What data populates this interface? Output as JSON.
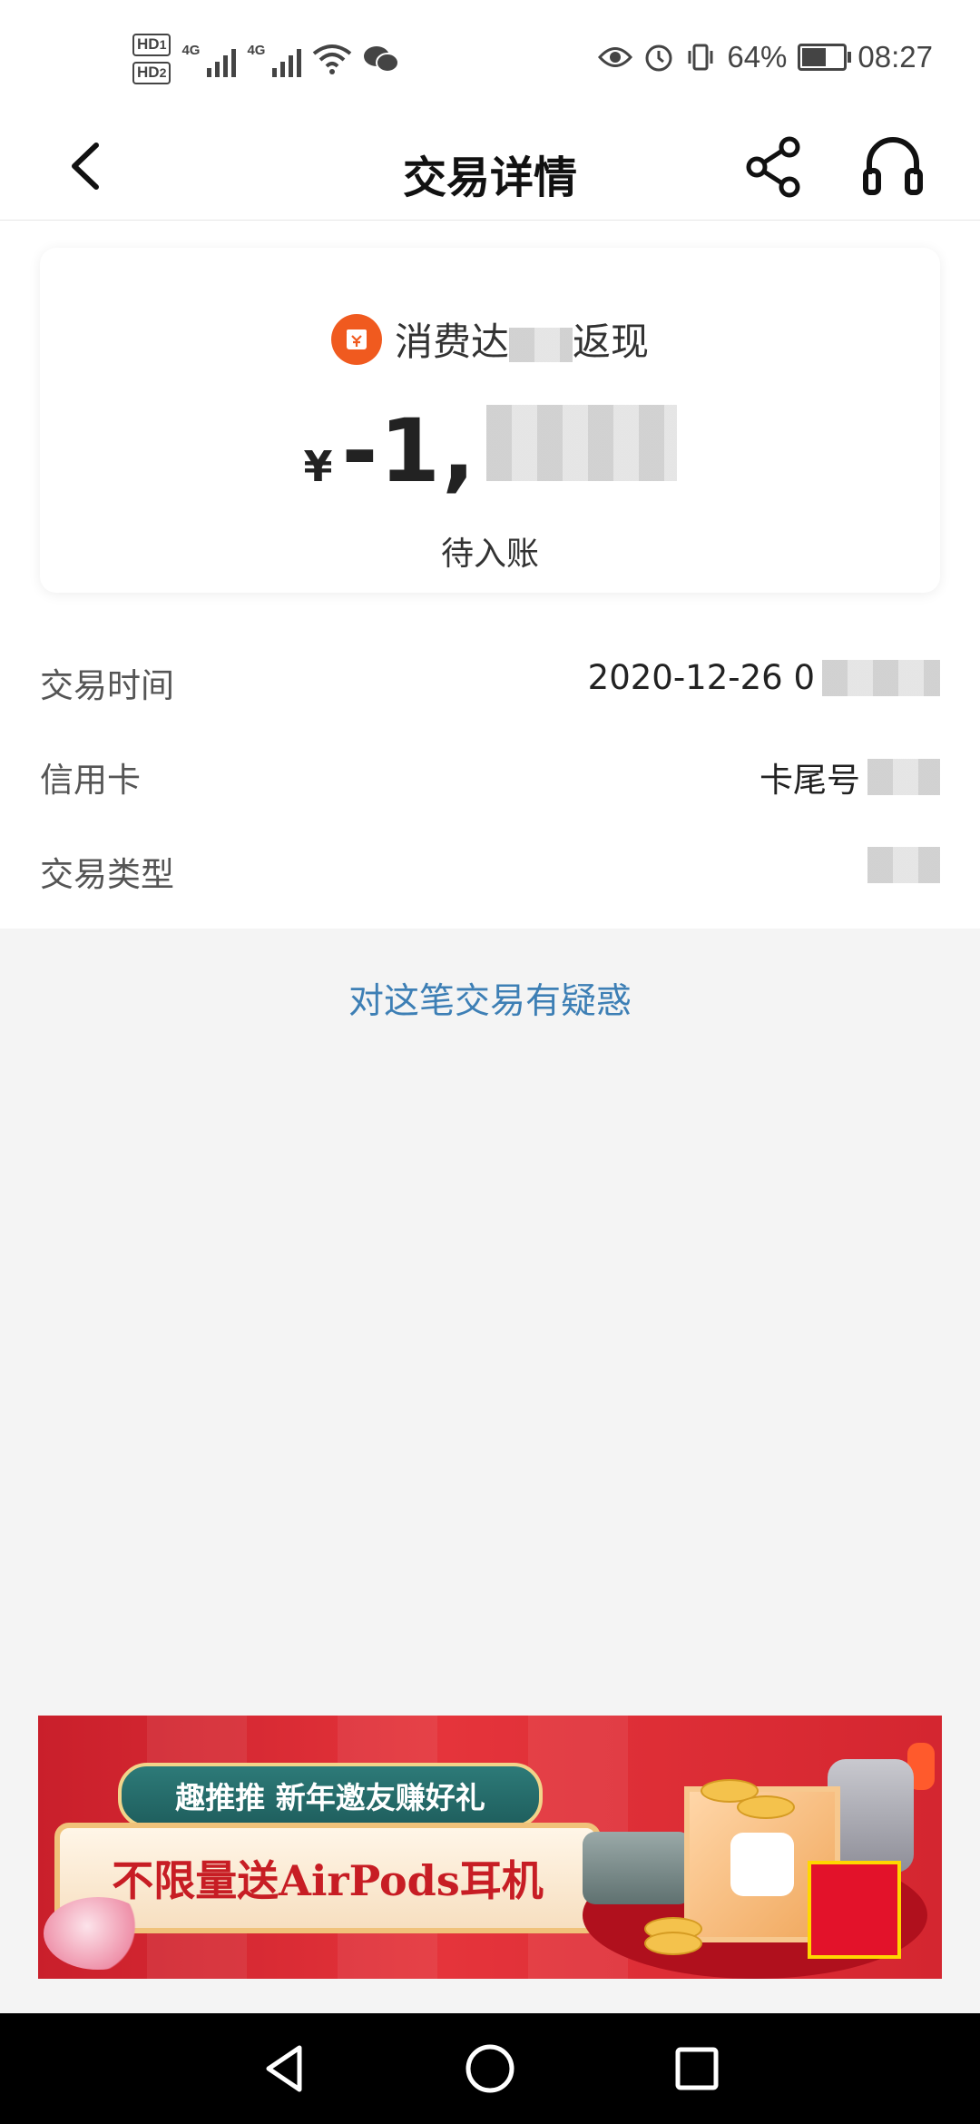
{
  "status_bar": {
    "sim1_label": "HD",
    "sim1_index": "1",
    "sim2_label": "HD",
    "sim2_index": "2",
    "network1": "4G",
    "network2": "4G",
    "battery_level": "64%",
    "battery_fraction": 0.64,
    "time": "08:27"
  },
  "header": {
    "title": "交易详情",
    "icons": [
      "back-icon",
      "share-icon",
      "customer-service-icon"
    ]
  },
  "summary": {
    "merchant_icon": "yen-bag-icon",
    "merchant_brand_color": "#f05a1f",
    "merchant_name": "消费达",
    "merchant_name_end": "返现",
    "currency_symbol": "¥",
    "amount_visible": "-1,",
    "status": "待入账"
  },
  "details": [
    {
      "label": "交易时间",
      "value": "2020-12-26 0"
    },
    {
      "label": "信用卡",
      "value": "卡尾号"
    },
    {
      "label": "交易类型",
      "value": ""
    }
  ],
  "doubt_link": "对这笔交易有疑惑",
  "banner": {
    "headline": "趣推推  新年邀友赚好礼",
    "main_text": "不限量送AirPods耳机"
  },
  "colors": {
    "link": "#3d7fb5",
    "banner_red": "#d42630",
    "background": "#f4f4f4"
  }
}
